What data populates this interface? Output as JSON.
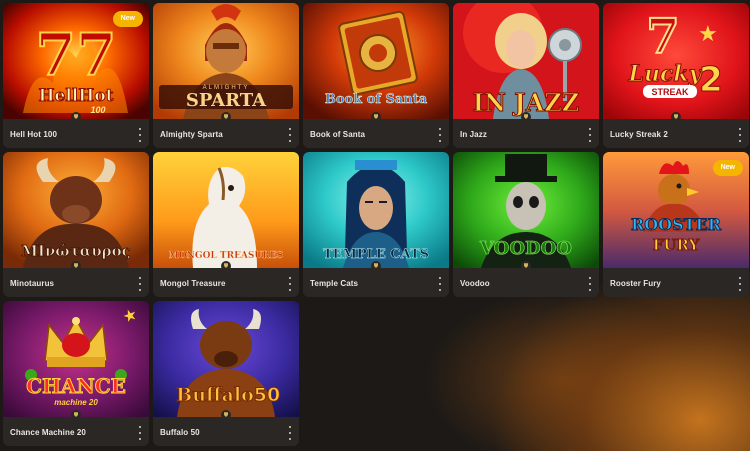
{
  "games": [
    {
      "title": "Hell Hot 100",
      "logo": "HellHot",
      "logo_sub": "100",
      "badge": "New",
      "theme": "fire-sevens"
    },
    {
      "title": "Almighty Sparta",
      "logo": "SPARTA",
      "logo_sub": "ALMIGHTY",
      "badge": "",
      "theme": "spartan"
    },
    {
      "title": "Book of Santa",
      "logo": "Book of Santa",
      "logo_sub": "",
      "badge": "",
      "theme": "book"
    },
    {
      "title": "In Jazz",
      "logo": "IN JAZZ",
      "logo_sub": "",
      "badge": "",
      "theme": "jazz-singer"
    },
    {
      "title": "Lucky Streak 2",
      "logo": "Lucky",
      "logo_sub": "STREAK",
      "logo_num": "2",
      "badge": "",
      "theme": "lucky-seven"
    },
    {
      "title": "Minotaurus",
      "logo": "MIνώταυρος",
      "logo_sub": "",
      "badge": "",
      "theme": "minotaur"
    },
    {
      "title": "Mongol Treasure",
      "logo": "MONGOL TREASURES",
      "logo_sub": "",
      "badge": "",
      "theme": "horse"
    },
    {
      "title": "Temple Cats",
      "logo": "TEMPLE CATS",
      "logo_sub": "",
      "badge": "",
      "theme": "egyptian"
    },
    {
      "title": "Voodoo",
      "logo": "VOODOO",
      "logo_sub": "",
      "badge": "",
      "theme": "voodoo"
    },
    {
      "title": "Rooster Fury",
      "logo": "ROOSTER",
      "logo_sub": "FURY",
      "badge": "New",
      "theme": "rooster"
    },
    {
      "title": "Chance Machine 20",
      "logo": "CHANCE",
      "logo_sub": "machine 20",
      "badge": "",
      "theme": "crown"
    },
    {
      "title": "Buffalo 50",
      "logo": "Buffalo",
      "logo_sub": "50",
      "badge": "",
      "theme": "buffalo"
    }
  ],
  "icons": {
    "more": "vertical-dots-icon",
    "trophy": "trophy-icon"
  },
  "colors": {
    "badge": "#f5b400",
    "card_footer": "#2b2724",
    "page_bg": "#1c1916"
  }
}
